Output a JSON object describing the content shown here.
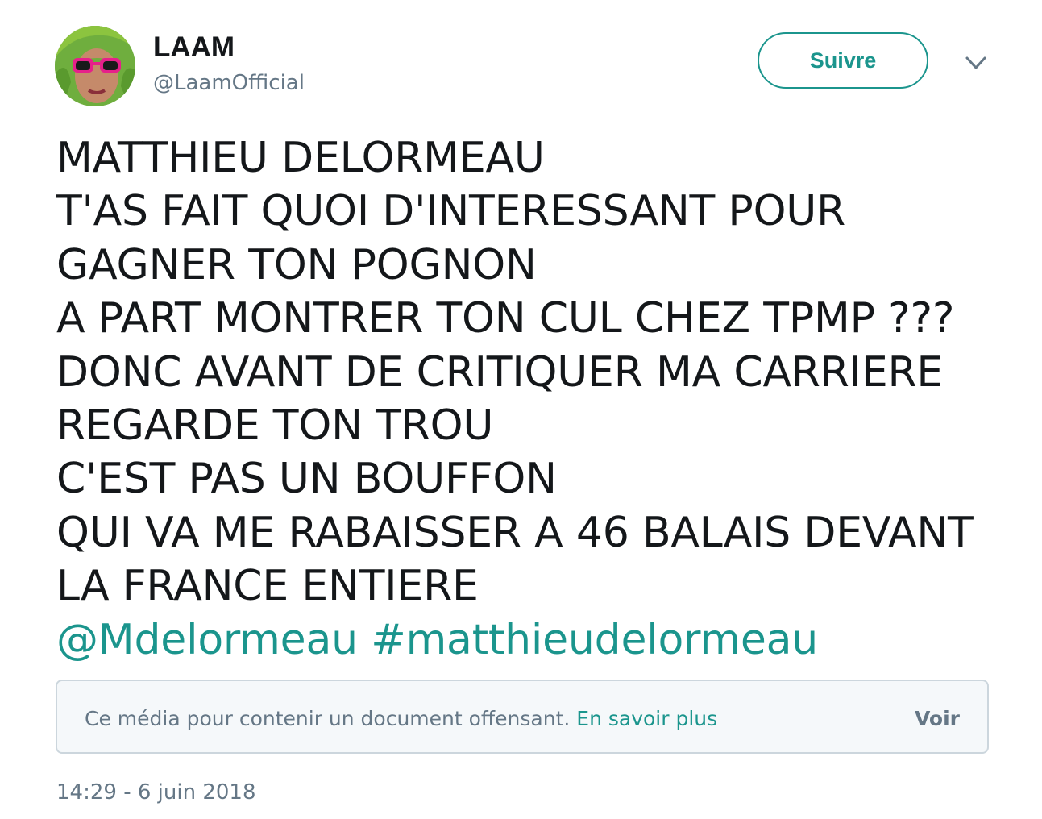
{
  "author": {
    "display_name": "LAAM",
    "handle": "@LaamOfficial",
    "avatar_icon": "profile-avatar"
  },
  "follow_button": {
    "label": "Suivre"
  },
  "menu": {
    "icon": "chevron-down-icon"
  },
  "tweet": {
    "lines": [
      "MATTHIEU DELORMEAU",
      "T'AS FAIT QUOI D'INTERESSANT POUR",
      "GAGNER TON POGNON",
      "A PART MONTRER TON CUL CHEZ TPMP ???",
      "DONC AVANT DE CRITIQUER MA CARRIERE",
      "REGARDE TON TROU",
      "C'EST PAS UN BOUFFON",
      "QUI VA ME RABAISSER A 46 BALAIS DEVANT",
      "LA FRANCE ENTIERE"
    ],
    "mention": "@Mdelormeau",
    "hashtag": "#matthieudelormeau"
  },
  "sensitive_media": {
    "message": "Ce média pour contenir un document offensant.",
    "learn_more": "En savoir plus",
    "view_label": "Voir"
  },
  "timestamp": "14:29 - 6 juin 2018",
  "colors": {
    "accent": "#1b958d",
    "text": "#14171a",
    "muted": "#657786",
    "border": "#ccd6dd",
    "box_bg": "#f5f8fa"
  }
}
